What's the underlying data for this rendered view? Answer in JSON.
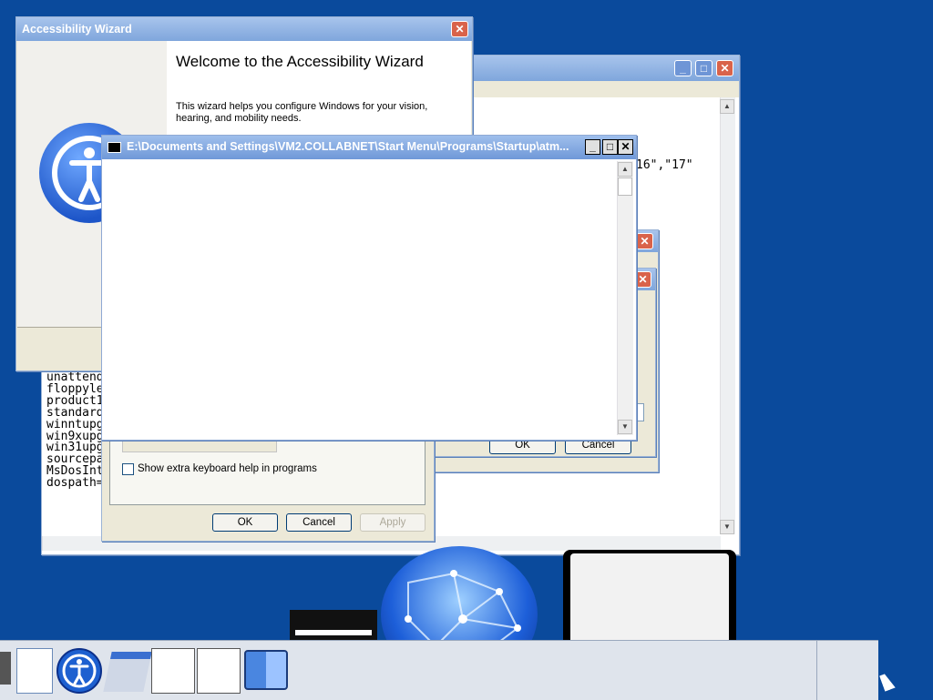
{
  "colors": {
    "desktop": "#0a4a9c",
    "title_active": "#0a246a",
    "title_inactive": "#7fa6dc"
  },
  "notepad": {
    "snippet": "16\",\"17\"",
    "lines": [
      "unattend",
      "floppyle",
      "product1",
      "standard",
      "winntupg",
      "win9xupg",
      "win31upg",
      "sourcepa",
      "MsDosInt",
      "dospath="
    ]
  },
  "accessibility_wizard": {
    "title": "Accessibility Wizard",
    "heading": "Welcome to the Accessibility Wizard",
    "body": "This wizard helps you configure Windows for your vision, hearing, and mobility needs.",
    "icon": "accessibility-person-icon"
  },
  "keyboard_dialog": {
    "checkbox_label": "Show extra keyboard help in programs",
    "ok": "OK",
    "cancel": "Cancel",
    "apply": "Apply"
  },
  "small_dialog": {
    "ok": "OK",
    "cancel": "Cancel"
  },
  "console": {
    "title": "E:\\Documents and Settings\\VM2.COLLABNET\\Start Menu\\Programs\\Startup\\atm...",
    "buttons": {
      "min": "_",
      "max": "□",
      "close": "✕"
    }
  },
  "dock": {
    "items": [
      "page-icon",
      "accessibility-icon",
      "window-icon",
      "window-icon",
      "window-icon",
      "finder-icon"
    ]
  },
  "glyphs": {
    "close": "✕",
    "min": "_",
    "max": "□",
    "up": "▲",
    "down": "▼",
    "left": "◀",
    "right": "▶"
  }
}
